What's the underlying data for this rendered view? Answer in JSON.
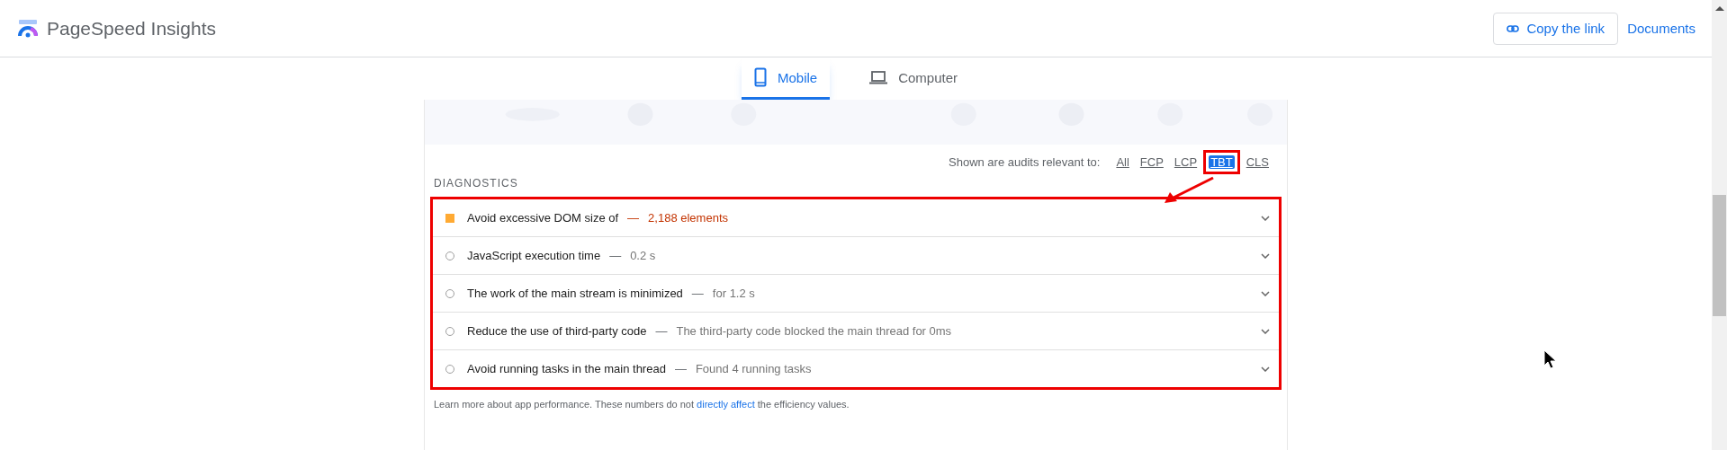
{
  "header": {
    "title": "PageSpeed Insights",
    "copy_button": "Copy the link",
    "docs_link": "Documents"
  },
  "tabs": [
    {
      "label": "Mobile",
      "selected": true,
      "kind": "phone"
    },
    {
      "label": "Computer",
      "selected": false,
      "kind": "laptop"
    }
  ],
  "filter": {
    "label": "Shown are audits relevant to:",
    "items": [
      {
        "label": "All",
        "selected": false,
        "highlighted": false
      },
      {
        "label": "FCP",
        "selected": false,
        "highlighted": false
      },
      {
        "label": "LCP",
        "selected": false,
        "highlighted": false
      },
      {
        "label": "TBT",
        "selected": true,
        "highlighted": true
      },
      {
        "label": "CLS",
        "selected": false,
        "highlighted": false
      }
    ]
  },
  "diagnostics": {
    "heading": "DIAGNOSTICS",
    "highlighted": true,
    "audits": [
      {
        "kind": "warn",
        "title": "Avoid excessive DOM size of",
        "separator": "—",
        "value": "2,188 elements",
        "expanded": false
      },
      {
        "kind": "info",
        "title": "JavaScript execution time",
        "separator": "—",
        "value": "0.2 s",
        "expanded": false
      },
      {
        "kind": "info",
        "title": "The work of the main stream is minimized",
        "separator": "—",
        "value": "for 1.2 s",
        "expanded": false
      },
      {
        "kind": "info",
        "title": "Reduce the use of third-party code",
        "separator": "—",
        "value": "The third-party code blocked the main thread for 0ms",
        "expanded": false
      },
      {
        "kind": "info",
        "title": "Avoid running tasks in the main thread",
        "separator": "—",
        "value": "Found 4 running tasks",
        "expanded": false
      }
    ]
  },
  "footnote": {
    "before": "Learn more about app performance. These numbers do not",
    "link": "directly affect",
    "after": "the efficiency values."
  }
}
